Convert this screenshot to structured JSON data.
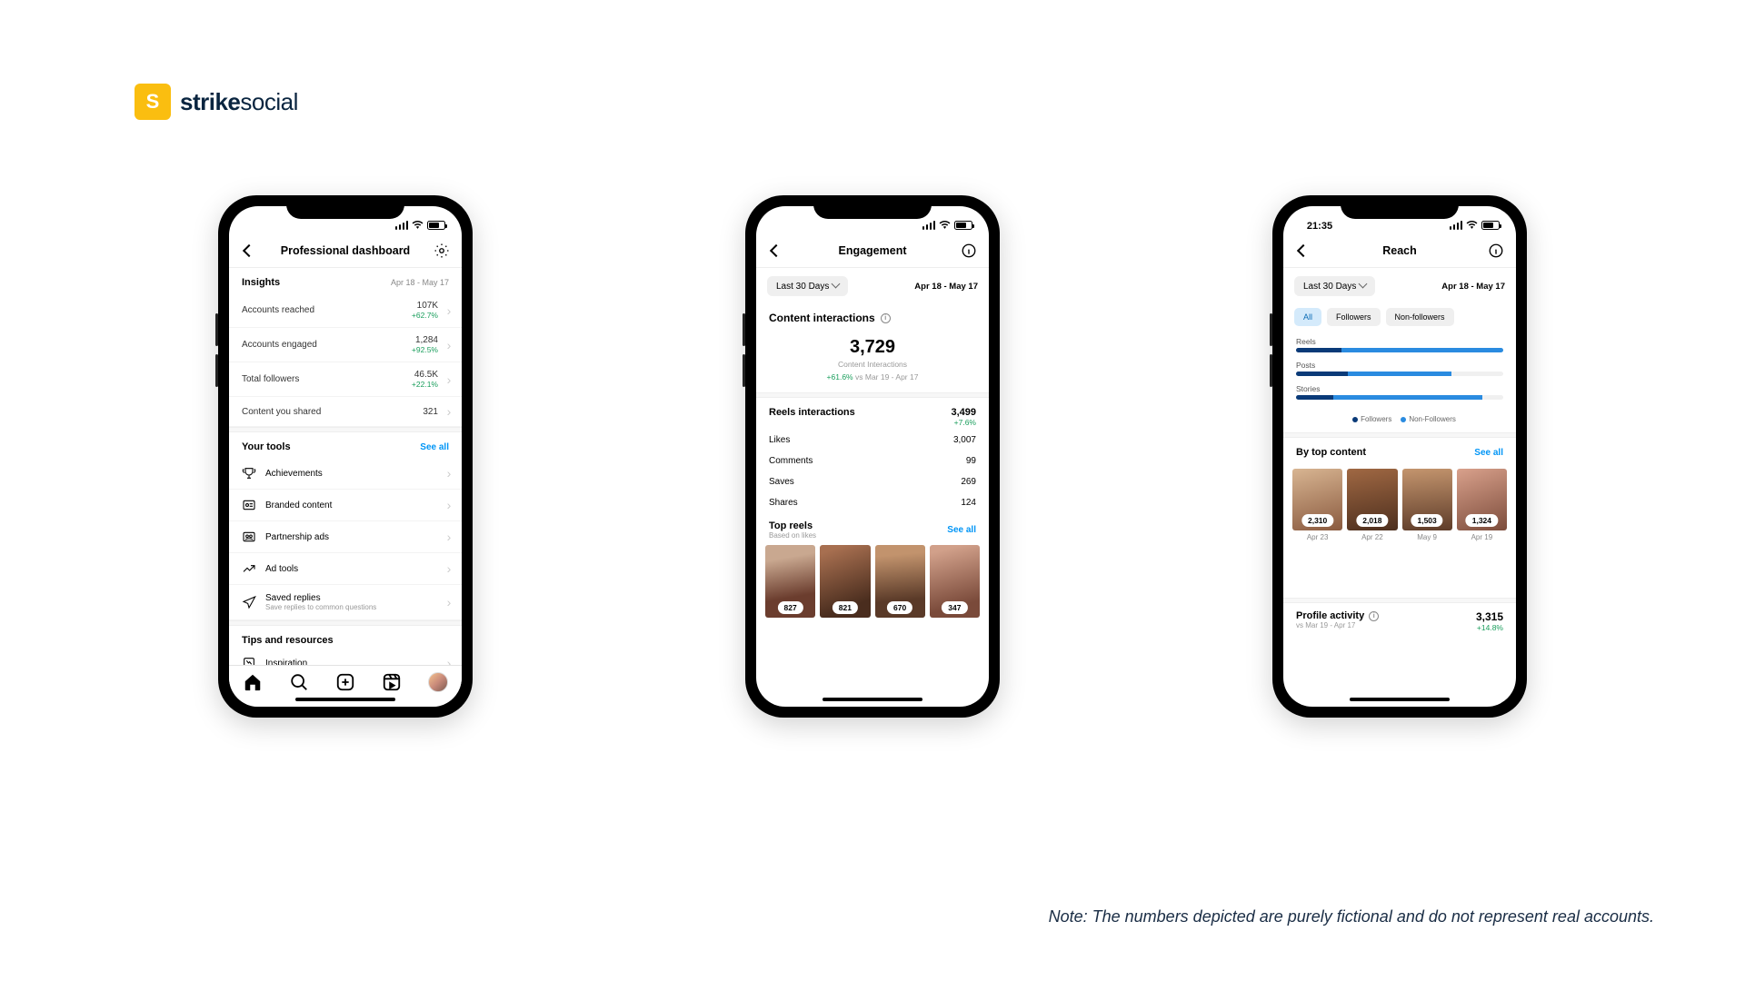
{
  "brand": {
    "name_bold": "strike",
    "name_reg": "social"
  },
  "footnote": "Note: The numbers depicted are purely fictional and do not represent real accounts.",
  "phone1": {
    "title": "Professional dashboard",
    "insights_label": "Insights",
    "date_range": "Apr 18 - May 17",
    "metrics": {
      "reached": {
        "label": "Accounts reached",
        "value": "107K",
        "change": "+62.7%"
      },
      "engaged": {
        "label": "Accounts engaged",
        "value": "1,284",
        "change": "+92.5%"
      },
      "followers": {
        "label": "Total followers",
        "value": "46.5K",
        "change": "+22.1%"
      },
      "shared": {
        "label": "Content you shared",
        "value": "321"
      }
    },
    "your_tools": "Your tools",
    "see_all": "See all",
    "tools": {
      "achievements": "Achievements",
      "branded": "Branded content",
      "partnership": "Partnership ads",
      "adtools": "Ad tools",
      "saved": "Saved replies",
      "saved_sub": "Save replies to common questions"
    },
    "tips": "Tips and resources",
    "inspiration": "Inspiration"
  },
  "phone2": {
    "title": "Engagement",
    "filter": "Last 30 Days",
    "date_range": "Apr 18 - May 17",
    "content_int": "Content interactions",
    "total": "3,729",
    "total_sub": "Content Interactions",
    "total_chg": "+61.6%",
    "total_cmp": "vs Mar 19 - Apr 17",
    "reels_int": "Reels interactions",
    "reels_val": "3,499",
    "reels_chg": "+7.6%",
    "likes": {
      "l": "Likes",
      "v": "3,007"
    },
    "comments": {
      "l": "Comments",
      "v": "99"
    },
    "saves": {
      "l": "Saves",
      "v": "269"
    },
    "shares": {
      "l": "Shares",
      "v": "124"
    },
    "top_reels": "Top reels",
    "top_reels_sub": "Based on likes",
    "see_all": "See all",
    "r": [
      "827",
      "821",
      "670",
      "347"
    ]
  },
  "phone3": {
    "time": "21:35",
    "title": "Reach",
    "filter": "Last 30 Days",
    "date_range": "Apr 18 - May 17",
    "seg": {
      "all": "All",
      "foll": "Followers",
      "nonf": "Non-followers"
    },
    "bars": {
      "reels": "Reels",
      "posts": "Posts",
      "stories": "Stories"
    },
    "legend": {
      "f": "Followers",
      "nf": "Non-Followers"
    },
    "by_top": "By top content",
    "see_all": "See all",
    "tc": [
      {
        "v": "2,310",
        "d": "Apr 23"
      },
      {
        "v": "2,018",
        "d": "Apr 22"
      },
      {
        "v": "1,503",
        "d": "May 9"
      },
      {
        "v": "1,324",
        "d": "Apr 19"
      }
    ],
    "profile_act": "Profile activity",
    "profile_cmp": "vs Mar 19 - Apr 17",
    "profile_val": "3,315",
    "profile_chg": "+14.8%"
  },
  "chart_data": {
    "type": "bar",
    "title": "Reach by content type",
    "stack_mode": "horizontal, two-series stacked, normalized width",
    "categories": [
      "Reels",
      "Posts",
      "Stories"
    ],
    "series": [
      {
        "name": "Followers",
        "color": "#0a3a78",
        "values_pct": [
          22,
          25,
          18
        ]
      },
      {
        "name": "Non-Followers",
        "color": "#2a8be0",
        "values_pct": [
          78,
          50,
          72
        ]
      }
    ],
    "legend": [
      "Followers",
      "Non-Followers"
    ],
    "xlim_pct": [
      0,
      100
    ]
  }
}
